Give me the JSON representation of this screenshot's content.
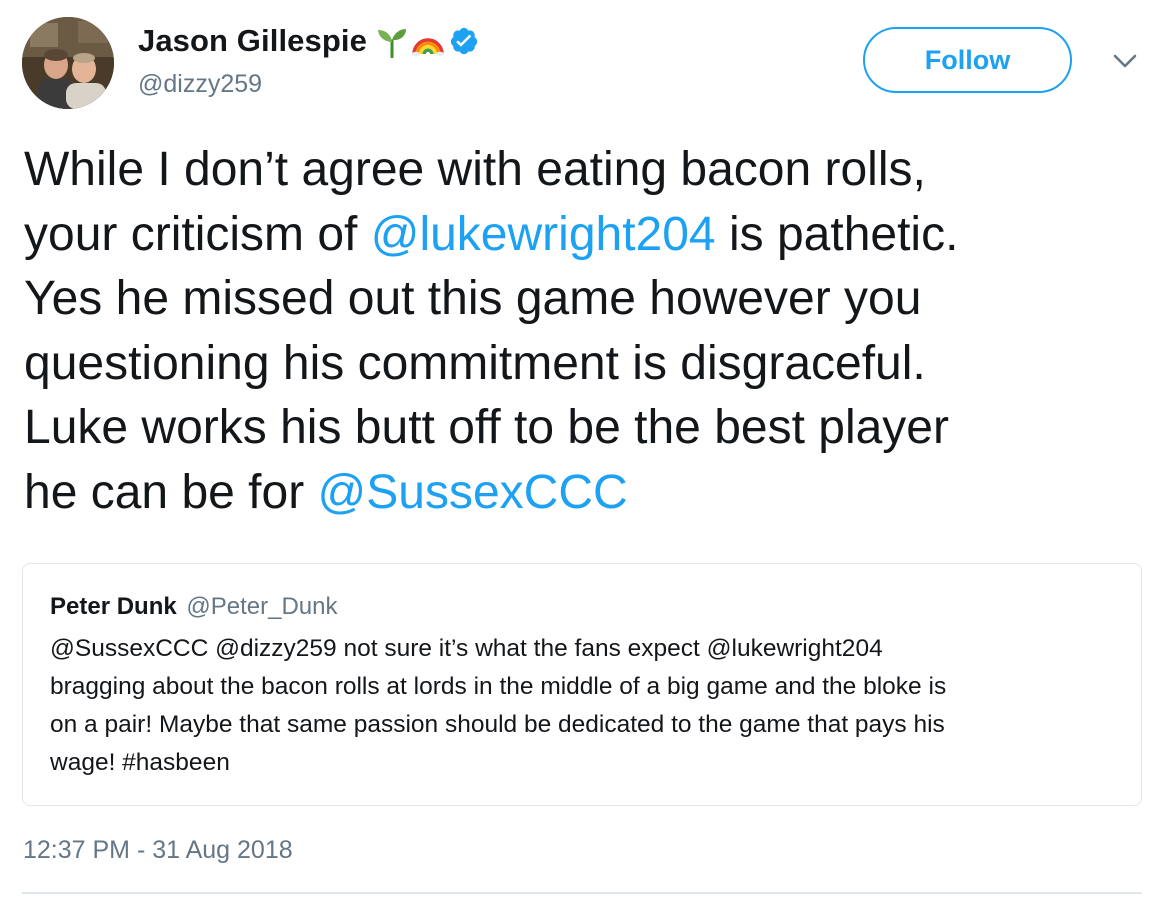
{
  "author": {
    "display_name": "Jason Gillespie",
    "handle": "@dizzy259",
    "badges": [
      "seedling-emoji",
      "rainbow-emoji",
      "verified-badge"
    ]
  },
  "follow_button_label": "Follow",
  "more_menu_icon": "chevron-down-icon",
  "tweet": {
    "line_1": "While I don’t agree with eating bacon rolls,",
    "line_2_before": "your criticism of ",
    "line_2_mention": "@lukewright204",
    "line_2_after": " is pathetic.",
    "line_3": "Yes he missed out this game however you",
    "line_4": "questioning his commitment is disgraceful.",
    "line_5": "Luke works his butt off to be the best player",
    "line_6_before": "he can be for ",
    "line_6_mention": "@SussexCCC"
  },
  "quoted_tweet": {
    "display_name": "Peter Dunk",
    "handle": "@Peter_Dunk",
    "lines": [
      "@SussexCCC @dizzy259 not sure it’s what the fans expect  @lukewright204",
      "bragging about the bacon rolls at lords in the middle of a big game and the bloke is",
      "on a pair! Maybe that same passion should be dedicated to the game that pays his",
      "wage! #hasbeen"
    ]
  },
  "timestamp": "12:37 PM - 31 Aug 2018",
  "colors": {
    "accent": "#1da1f2",
    "text": "#14171a",
    "secondary_text": "#657786",
    "border": "#e1e8ed"
  }
}
